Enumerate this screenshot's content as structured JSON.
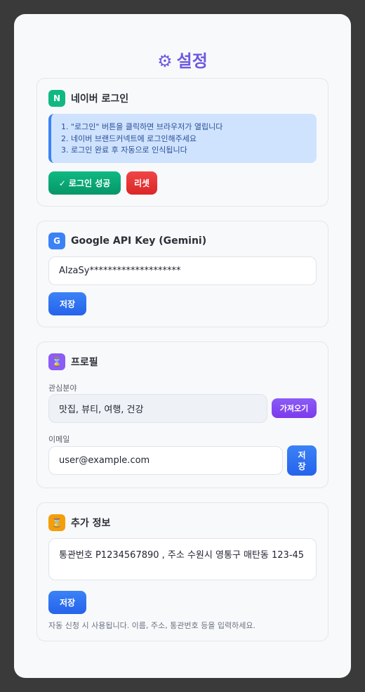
{
  "header": {
    "title": "설정",
    "icon": "gear-icon"
  },
  "naver": {
    "badge": "N",
    "title": "네이버 로그인",
    "steps": [
      "1. \"로그인\" 버튼을 클릭하면 브라우저가 열립니다",
      "2. 네이버 브랜드커넥트에 로그인해주세요",
      "3. 로그인 완료 후 자동으로 인식됩니다"
    ],
    "success_label": "✓ 로그인 성공",
    "reset_label": "리셋"
  },
  "google": {
    "badge": "G",
    "title": "Google API Key (Gemini)",
    "api_key_value": "AIzaSy********************",
    "save_label": "저장"
  },
  "profile": {
    "icon": "hourglass-icon",
    "title": "프로필",
    "interests_label": "관심분야",
    "interests_value": "맛집, 뷰티, 여행, 건강",
    "fetch_label": "가져오기",
    "email_label": "이메일",
    "email_value": "user@example.com",
    "save_label": "저\n장"
  },
  "extra": {
    "icon": "hourglass-icon",
    "title": "추가 정보",
    "text_value": "통관번호 P1234567890 , 주소 수원시 영통구 매탄동 123-45",
    "save_label": "저장",
    "hint": "자동 신청 시 사용됩니다. 이름, 주소, 통관번호 등을 입력하세요."
  },
  "colors": {
    "accent": "#6b5be0",
    "naver_green": "#10b981",
    "google_blue": "#3b82f6",
    "profile_purple": "#8b5cf6",
    "extra_orange": "#f59e0b",
    "reset_red": "#ef4444"
  }
}
